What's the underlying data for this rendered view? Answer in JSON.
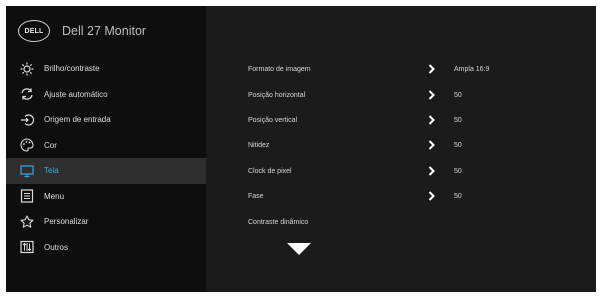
{
  "header": {
    "logo": "DELL",
    "title": "Dell 27 Monitor"
  },
  "menu": {
    "items": [
      {
        "label": "Brilho/contraste",
        "icon": "brightness-icon"
      },
      {
        "label": "Ajuste automático",
        "icon": "auto-adjust-icon"
      },
      {
        "label": "Origem de entrada",
        "icon": "input-source-icon"
      },
      {
        "label": "Cor",
        "icon": "color-palette-icon"
      },
      {
        "label": "Tela",
        "icon": "display-icon"
      },
      {
        "label": "Menu",
        "icon": "menu-list-icon"
      },
      {
        "label": "Personalizar",
        "icon": "star-icon"
      },
      {
        "label": "Outros",
        "icon": "others-icon"
      }
    ],
    "active_index": 4
  },
  "settings": [
    {
      "name": "Formato de imagem",
      "value": "Ampla 16:9"
    },
    {
      "name": "Posição horizontal",
      "value": "50"
    },
    {
      "name": "Posição vertical",
      "value": "50"
    },
    {
      "name": "Nitidez",
      "value": "50"
    },
    {
      "name": "Clock de pixel",
      "value": "50"
    },
    {
      "name": "Fase",
      "value": "50"
    },
    {
      "name": "Contraste dinâmico",
      "value": ""
    }
  ],
  "colors": {
    "accent": "#3aa7e0",
    "panel": "#1b1b1b",
    "sidebar": "#0e0e0e"
  }
}
